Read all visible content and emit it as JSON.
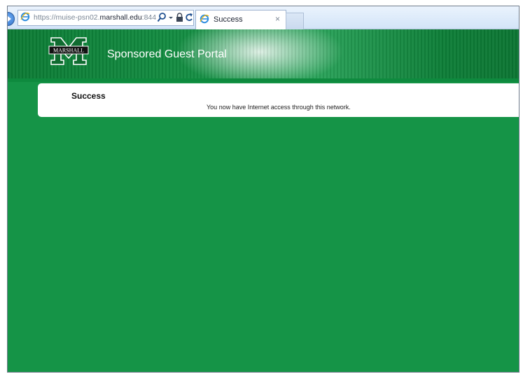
{
  "browser": {
    "url_scheme": "https://",
    "url_host_prefix": "muise-psn02.",
    "url_domain": "marshall.edu",
    "url_port": ":844",
    "tab_title": "Success",
    "tab_close": "×",
    "icons": [
      "back-icon",
      "ie-logo-icon",
      "search-icon",
      "dropdown-icon",
      "lock-icon",
      "refresh-icon",
      "close-icon"
    ]
  },
  "portal": {
    "logo_text": "MARSHALL",
    "title": "Sponsored Guest Portal",
    "colors": {
      "background": "#159447",
      "banner": "#0b7a33",
      "card": "#ffffff"
    }
  },
  "content": {
    "heading": "Success",
    "message": "You now have Internet access through this network."
  }
}
